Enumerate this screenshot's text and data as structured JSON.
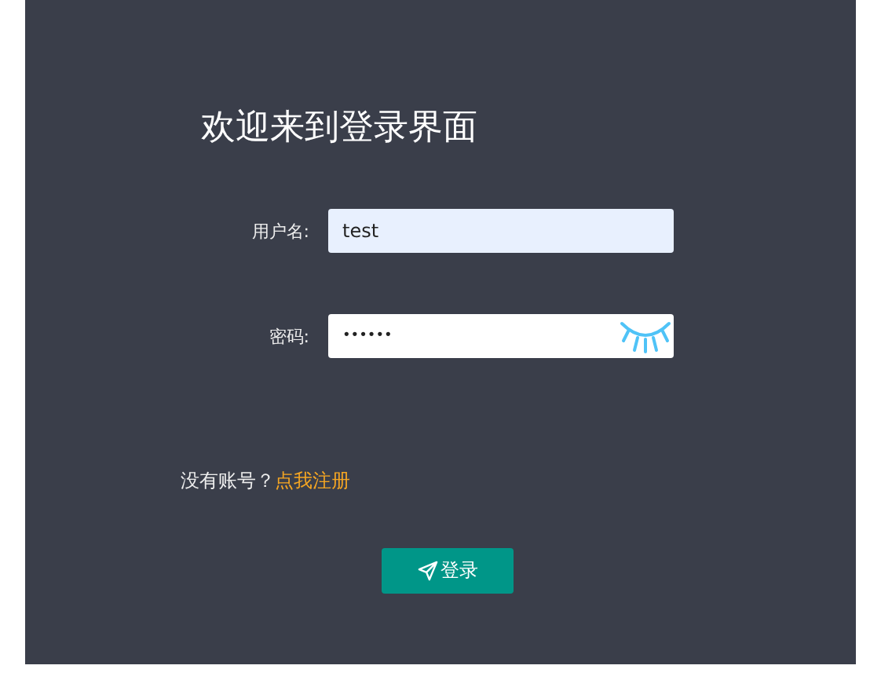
{
  "title": "欢迎来到登录界面",
  "fields": [
    {
      "label": "用户名:",
      "value": "test",
      "kind": "text",
      "autofilled": true
    },
    {
      "label": "密码:",
      "value": "••••••",
      "kind": "password",
      "revealed": false
    }
  ],
  "register": {
    "prompt": "没有账号？",
    "link": "点我注册"
  },
  "button": {
    "label": "登录"
  }
}
